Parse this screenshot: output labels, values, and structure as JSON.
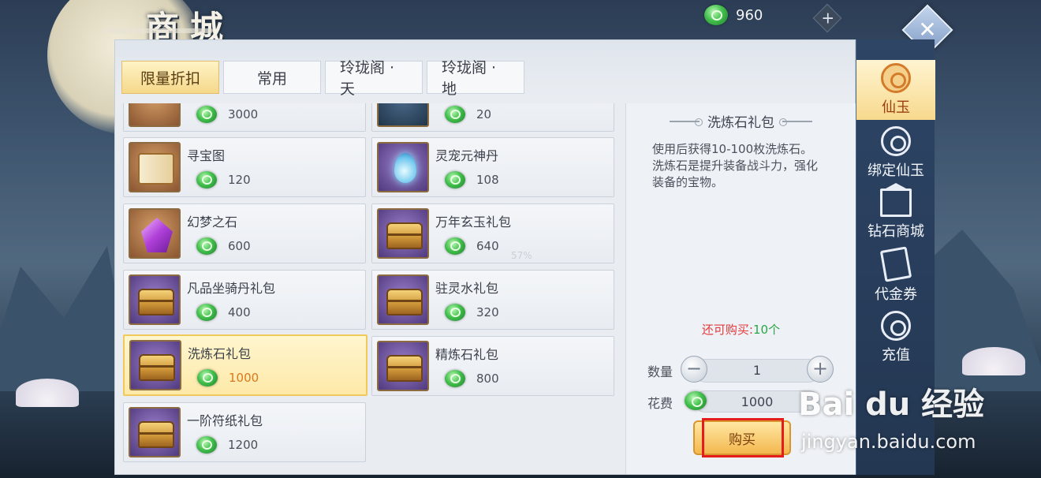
{
  "header": {
    "title": "商城",
    "currency_value": "960",
    "plus_label": "+",
    "close_label": "✕"
  },
  "tabs": [
    {
      "label": "限量折扣",
      "active": true
    },
    {
      "label": "常用",
      "active": false
    },
    {
      "label": "玲珑阁 · 天",
      "active": false
    },
    {
      "label": "玲珑阁 · 地",
      "active": false
    }
  ],
  "items": [
    {
      "name": "",
      "price": "3000",
      "icon": "box-icon"
    },
    {
      "name": "",
      "price": "20",
      "icon": "green-gem-icon"
    },
    {
      "name": "寻宝图",
      "price": "120",
      "icon": "treasure-map-icon"
    },
    {
      "name": "灵宠元神丹",
      "price": "108",
      "icon": "spirit-orb-icon"
    },
    {
      "name": "幻梦之石",
      "price": "600",
      "icon": "purple-crystal-icon"
    },
    {
      "name": "万年玄玉礼包",
      "price": "640",
      "icon": "treasure-chest-icon"
    },
    {
      "name": "凡品坐骑丹礼包",
      "price": "400",
      "icon": "treasure-chest-icon"
    },
    {
      "name": "驻灵水礼包",
      "price": "320",
      "icon": "treasure-chest-icon"
    },
    {
      "name": "洗炼石礼包",
      "price": "1000",
      "icon": "treasure-chest-icon",
      "selected": true
    },
    {
      "name": "精炼石礼包",
      "price": "800",
      "icon": "treasure-chest-icon"
    },
    {
      "name": "一阶符纸礼包",
      "price": "1200",
      "icon": "treasure-chest-icon"
    }
  ],
  "detail": {
    "title": "洗炼石礼包",
    "description": "使用后获得10-100枚洗炼石。洗炼石是提升装备战斗力，强化装备的宝物。",
    "remain_label": "还可购买:",
    "remain_count": "10个",
    "qty_label": "数量",
    "qty_value": "1",
    "minus_label": "−",
    "plus_label": "+",
    "cost_label": "花费",
    "cost_value": "1000",
    "buy_label": "购买"
  },
  "overlay_percent": "57%",
  "sidebar": [
    {
      "label": "仙玉",
      "active": true,
      "icon": "jade-emblem-icon"
    },
    {
      "label": "绑定仙玉",
      "active": false,
      "icon": "bound-jade-icon"
    },
    {
      "label": "钻石商城",
      "active": false,
      "icon": "store-icon"
    },
    {
      "label": "代金券",
      "active": false,
      "icon": "voucher-icon"
    },
    {
      "label": "充值",
      "active": false,
      "icon": "recharge-icon"
    }
  ],
  "watermark": {
    "brand": "Bai du 经验",
    "url": "jingyan.baidu.com"
  },
  "colors": {
    "accent_gold": "#f3b84f",
    "remain_red": "#e23a3a",
    "remain_green": "#28a745",
    "selected_price": "#d8791d",
    "highlight_red": "#e41c1c"
  }
}
